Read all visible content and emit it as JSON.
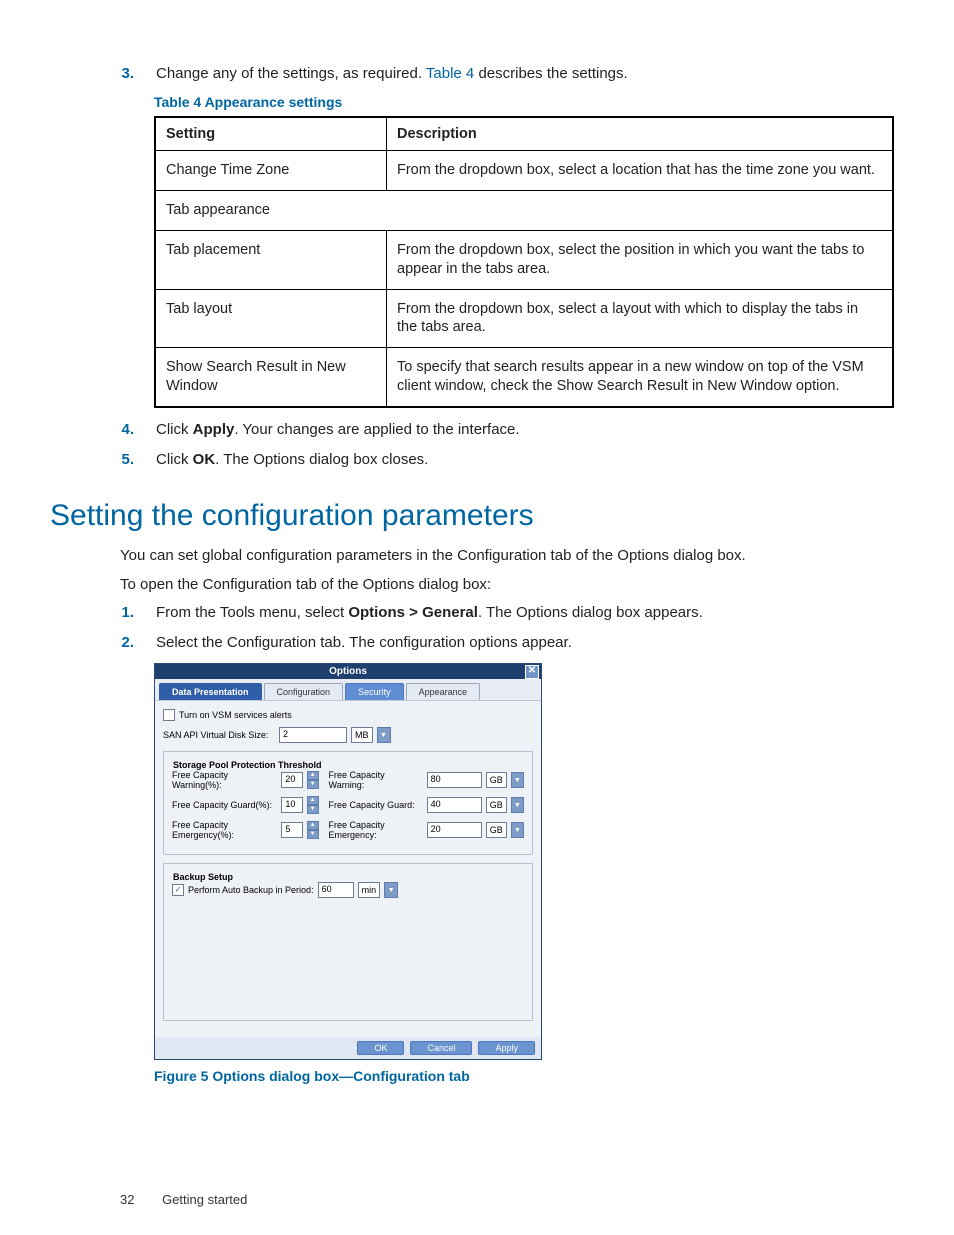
{
  "list": {
    "n3": "3.",
    "t3_a": "Change any of the settings, as required. ",
    "t3_link": "Table 4",
    "t3_b": " describes the settings.",
    "n4": "4.",
    "t4_a": "Click ",
    "t4_bold": "Apply",
    "t4_b": ". Your changes are applied to the interface.",
    "n5": "5.",
    "t5_a": "Click ",
    "t5_bold": "OK",
    "t5_b": ". The Options dialog box closes."
  },
  "table": {
    "caption": "Table 4 Appearance settings",
    "h1": "Setting",
    "h2": "Description",
    "r1c1": "Change Time Zone",
    "r1c2": "From the dropdown box, select a location that has the time zone you want.",
    "r2c1": "Tab appearance",
    "r3c1": "Tab placement",
    "r3c2": "From the dropdown box, select the position in which you want the tabs to appear in the tabs area.",
    "r4c1": "Tab layout",
    "r4c2": "From the dropdown box, select a layout with which to display the tabs in the tabs area.",
    "r5c1": "Show Search Result in New Window",
    "r5c2": "To specify that search results appear in a new window on top of the VSM client window, check the Show Search Result in New Window option."
  },
  "section": {
    "heading": "Setting the configuration parameters",
    "p1": "You can set global configuration parameters in the Configuration tab of the Options dialog box.",
    "p2": "To open the Configuration tab of the Options dialog box:",
    "n1": "1.",
    "t1_a": "From the Tools menu, select ",
    "t1_bold": "Options > General",
    "t1_b": ". The Options dialog box appears.",
    "n2": "2.",
    "t2": "Select the Configuration tab. The configuration options appear."
  },
  "dialog": {
    "title": "Options",
    "close": "✕",
    "tabs": {
      "t1": "Data Presentation",
      "t2": "Configuration",
      "t3": "Security",
      "t4": "Appearance"
    },
    "alerts_label": "Turn on VSM services alerts",
    "vdisk_label": "SAN API Virtual Disk Size:",
    "vdisk_value": "2",
    "vdisk_unit": "MB",
    "dd": "▼",
    "spin_up": "▲",
    "spin_dn": "▼",
    "fs1_title": "Storage Pool Protection Threshold",
    "row_w": {
      "l1": "Free Capacity Warning(%):",
      "v1": "20",
      "l2": "Free Capacity Warning:",
      "v2": "80",
      "u": "GB"
    },
    "row_g": {
      "l1": "Free Capacity Guard(%):",
      "v1": "10",
      "l2": "Free Capacity Guard:",
      "v2": "40",
      "u": "GB"
    },
    "row_e": {
      "l1": "Free Capacity Emergency(%):",
      "v1": "5",
      "l2": "Free Capacity Emergency:",
      "v2": "20",
      "u": "GB"
    },
    "fs2_title": "Backup Setup",
    "backup_chk": "✓",
    "backup_label": "Perform Auto Backup in Period:",
    "backup_value": "60",
    "backup_unit": "min",
    "btn_ok": "OK",
    "btn_cancel": "Cancel",
    "btn_apply": "Apply"
  },
  "figure_caption": "Figure 5 Options dialog box—Configuration tab",
  "footer": {
    "page": "32",
    "section": "Getting started"
  }
}
